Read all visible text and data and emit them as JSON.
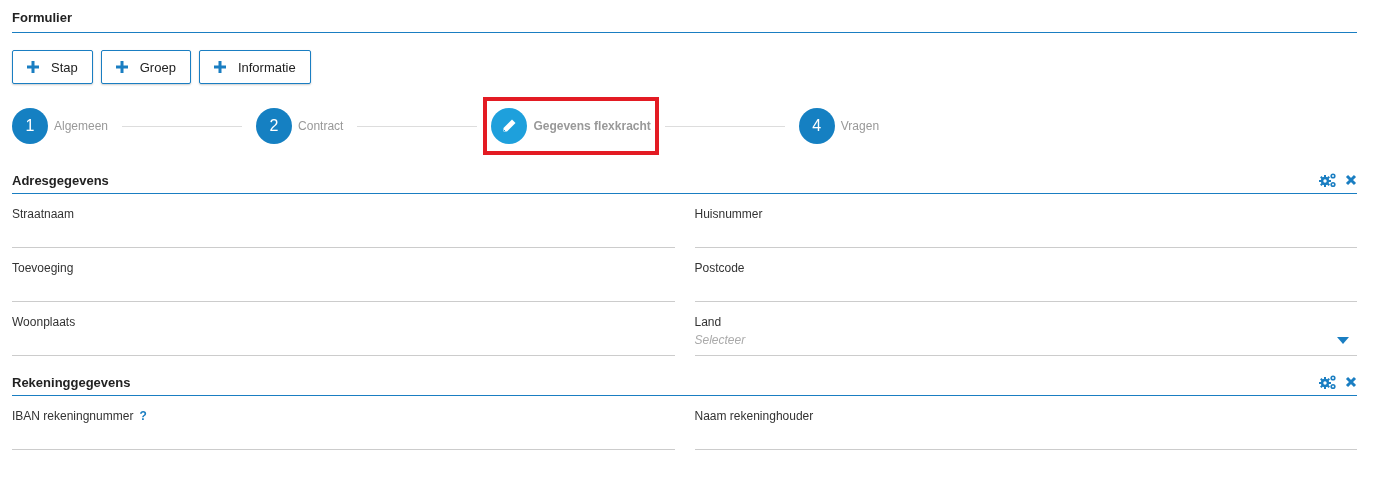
{
  "title": "Formulier",
  "buttons": [
    {
      "label": "Stap"
    },
    {
      "label": "Groep"
    },
    {
      "label": "Informatie"
    }
  ],
  "steps": [
    {
      "number": "1",
      "label": "Algemeen",
      "selected": false,
      "highlighted": false
    },
    {
      "number": "2",
      "label": "Contract",
      "selected": false,
      "highlighted": false
    },
    {
      "label": "Gegevens flexkracht",
      "selected": true,
      "highlighted": true
    },
    {
      "number": "4",
      "label": "Vragen",
      "selected": false,
      "highlighted": false
    }
  ],
  "sections": [
    {
      "title": "Adresgegevens",
      "fields": [
        {
          "label": "Straatnaam",
          "kind": "text"
        },
        {
          "label": "Huisnummer",
          "kind": "text"
        },
        {
          "label": "Toevoeging",
          "kind": "text"
        },
        {
          "label": "Postcode",
          "kind": "text"
        },
        {
          "label": "Woonplaats",
          "kind": "text"
        },
        {
          "label": "Land",
          "kind": "select",
          "placeholder": "Selecteer"
        }
      ]
    },
    {
      "title": "Rekeninggegevens",
      "fields": [
        {
          "label": "IBAN rekeningnummer",
          "kind": "text",
          "help": "?"
        },
        {
          "label": "Naam rekeninghouder",
          "kind": "text"
        }
      ]
    }
  ]
}
